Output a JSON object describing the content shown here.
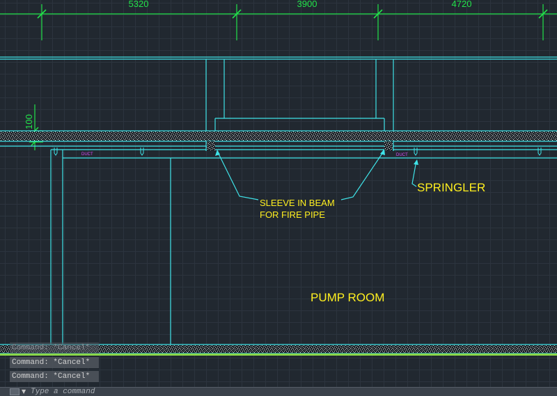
{
  "drawing": {
    "dimensions": [
      "5320",
      "3900",
      "4720"
    ],
    "vertical_dimension": "100",
    "annotations": {
      "sleeve_line1": "SLEEVE IN BEAM",
      "sleeve_line2": "FOR FIRE PIPE",
      "sprinkler": "SPRINGLER",
      "room": "PUMP ROOM",
      "duct_left": "DUCT",
      "duct_right": "DUCT"
    }
  },
  "command": {
    "history": [
      "Command: *Cancel*",
      "Command: *Cancel*",
      "Command: *Cancel*"
    ],
    "placeholder": "Type a command"
  },
  "colors": {
    "background": "#212830",
    "dimension": "#22e34a",
    "outline": "#3fe3e8",
    "text": "#ffef1f",
    "duct": "#e04cff"
  }
}
